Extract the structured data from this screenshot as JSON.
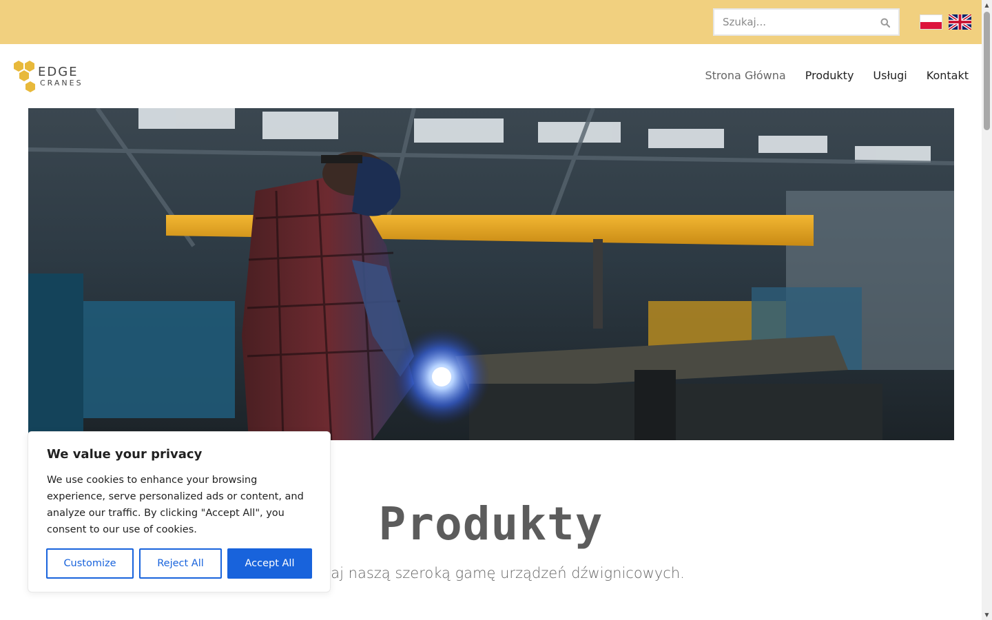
{
  "search": {
    "placeholder": "Szukaj...",
    "icon": "search-icon"
  },
  "languages": [
    {
      "code": "pl",
      "icon": "flag-poland-icon"
    },
    {
      "code": "en",
      "icon": "flag-uk-icon"
    }
  ],
  "logo": {
    "line1": "EDGE",
    "line2": "CRANES",
    "color": "#e8b93b"
  },
  "nav": {
    "items": [
      {
        "label": "Strona Główna",
        "active": true
      },
      {
        "label": "Produkty",
        "active": false
      },
      {
        "label": "Usługi",
        "active": false
      },
      {
        "label": "Kontakt",
        "active": false
      }
    ]
  },
  "section": {
    "title": "Produkty",
    "subtitle": "Poznaj naszą szeroką gamę urządzeń dźwignicowych."
  },
  "cookie": {
    "title": "We value your privacy",
    "text": "We use cookies to enhance your browsing experience, serve personalized ads or content, and analyze our traffic. By clicking \"Accept All\", you consent to our use of cookies.",
    "customize": "Customize",
    "reject": "Reject All",
    "accept": "Accept All"
  },
  "colors": {
    "topbar": "#f1d07f",
    "accent": "#1863dc",
    "brand_yellow": "#e8b93b"
  }
}
